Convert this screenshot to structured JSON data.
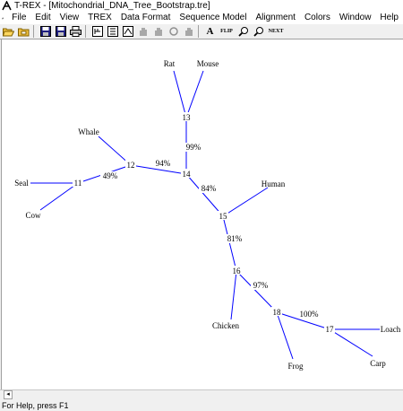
{
  "window": {
    "title": "T-REX - [Mitochondrial_DNA_Tree_Bootstrap.tre]"
  },
  "menu": [
    "File",
    "Edit",
    "View",
    "TREX",
    "Data Format",
    "Sequence Model",
    "Alignment",
    "Colors",
    "Window",
    "Help"
  ],
  "toolbar": {
    "buttons": [
      {
        "name": "open-folder-icon",
        "icon": "folder-open"
      },
      {
        "name": "open-file-icon",
        "icon": "folder"
      },
      {
        "name": "save-icon",
        "icon": "floppy"
      },
      {
        "name": "save-as-icon",
        "icon": "floppy"
      },
      {
        "name": "print-icon",
        "icon": "printer"
      },
      {
        "name": "tree-view-1-icon",
        "icon": "tree-grid"
      },
      {
        "name": "tree-view-2-icon",
        "icon": "tree-grid"
      },
      {
        "name": "tree-view-3-icon",
        "icon": "tree-grid"
      },
      {
        "name": "hand-tool-1-icon",
        "icon": "hand"
      },
      {
        "name": "hand-tool-2-icon",
        "icon": "hand"
      },
      {
        "name": "hand-tool-3-icon",
        "icon": "hand"
      },
      {
        "name": "hand-tool-4-icon",
        "icon": "hand"
      },
      {
        "name": "font-icon",
        "icon": "letter-a"
      },
      {
        "name": "flip-icon",
        "icon": "flip"
      },
      {
        "name": "zoom-in-icon",
        "icon": "magnifier"
      },
      {
        "name": "zoom-out-icon",
        "icon": "magnifier"
      },
      {
        "name": "next-icon",
        "icon": "next"
      }
    ],
    "text_labels": {
      "font": "A",
      "flip": "FLIP",
      "next": "NEXT"
    }
  },
  "tree": {
    "nodes": [
      {
        "id": "Rat",
        "label": "Rat"
      },
      {
        "id": "Mouse",
        "label": "Mouse"
      },
      {
        "id": "n13",
        "label": "13"
      },
      {
        "id": "Whale",
        "label": "Whale"
      },
      {
        "id": "n12",
        "label": "12"
      },
      {
        "id": "n14",
        "label": "14"
      },
      {
        "id": "Seal",
        "label": "Seal"
      },
      {
        "id": "n11",
        "label": "11"
      },
      {
        "id": "Human",
        "label": "Human"
      },
      {
        "id": "Cow",
        "label": "Cow"
      },
      {
        "id": "n15",
        "label": "15"
      },
      {
        "id": "n16",
        "label": "16"
      },
      {
        "id": "n18",
        "label": "18"
      },
      {
        "id": "Chicken",
        "label": "Chicken"
      },
      {
        "id": "n17",
        "label": "17"
      },
      {
        "id": "Loach",
        "label": "Loach"
      },
      {
        "id": "Frog",
        "label": "Frog"
      },
      {
        "id": "Carp",
        "label": "Carp"
      }
    ],
    "edges": [
      {
        "from": "n13",
        "to": "Rat"
      },
      {
        "from": "n13",
        "to": "Mouse"
      },
      {
        "from": "n14",
        "to": "n13",
        "bootstrap": "99%"
      },
      {
        "from": "n12",
        "to": "Whale"
      },
      {
        "from": "n14",
        "to": "n12",
        "bootstrap": "94%"
      },
      {
        "from": "n12",
        "to": "n11",
        "bootstrap": "49%"
      },
      {
        "from": "n11",
        "to": "Seal"
      },
      {
        "from": "n11",
        "to": "Cow"
      },
      {
        "from": "n15",
        "to": "n14",
        "bootstrap": "84%"
      },
      {
        "from": "n15",
        "to": "Human"
      },
      {
        "from": "n15",
        "to": "n16",
        "bootstrap": "81%"
      },
      {
        "from": "n16",
        "to": "Chicken"
      },
      {
        "from": "n16",
        "to": "n18",
        "bootstrap": "97%"
      },
      {
        "from": "n18",
        "to": "Frog"
      },
      {
        "from": "n18",
        "to": "n17",
        "bootstrap": "100%"
      },
      {
        "from": "n17",
        "to": "Loach"
      },
      {
        "from": "n17",
        "to": "Carp"
      }
    ],
    "branch_color": "#0000ff"
  },
  "status": {
    "text": "For Help, press F1"
  }
}
